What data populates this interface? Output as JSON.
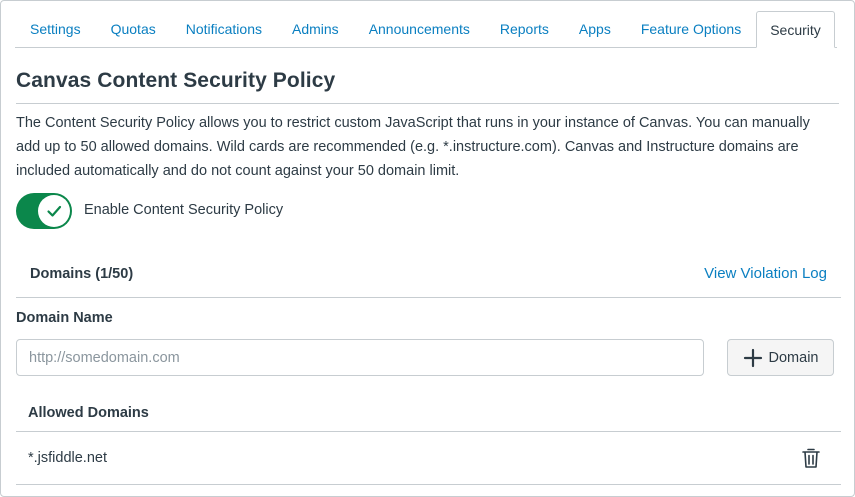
{
  "tabs": [
    {
      "label": "Settings"
    },
    {
      "label": "Quotas"
    },
    {
      "label": "Notifications"
    },
    {
      "label": "Admins"
    },
    {
      "label": "Announcements"
    },
    {
      "label": "Reports"
    },
    {
      "label": "Apps"
    },
    {
      "label": "Feature Options"
    },
    {
      "label": "Security",
      "active": true
    }
  ],
  "page": {
    "title": "Canvas Content Security Policy",
    "description": "The Content Security Policy allows you to restrict custom JavaScript that runs in your instance of Canvas. You can manually add up to 50 allowed domains. Wild cards are recommended (e.g. *.instructure.com). Canvas and Instructure domains are included automatically and do not count against your 50 domain limit."
  },
  "toggle": {
    "label": "Enable Content Security Policy",
    "enabled": true,
    "icon": "checkmark-icon"
  },
  "domains": {
    "count_label": "Domains (1/50)",
    "violation_log_label": "View Violation Log",
    "field_label": "Domain Name",
    "input_placeholder": "http://somedomain.com",
    "input_value": "",
    "add_button_label": "Domain",
    "add_button_icon": "plus-icon",
    "allowed_label": "Allowed Domains",
    "allowed": [
      {
        "domain": "*.jsfiddle.net",
        "delete_icon": "trash-icon"
      }
    ]
  },
  "colors": {
    "link": "#0a7fc1",
    "text": "#2d3b45",
    "toggle_on": "#0b874b",
    "border": "#c7cdd1",
    "placeholder": "#8b969e"
  }
}
